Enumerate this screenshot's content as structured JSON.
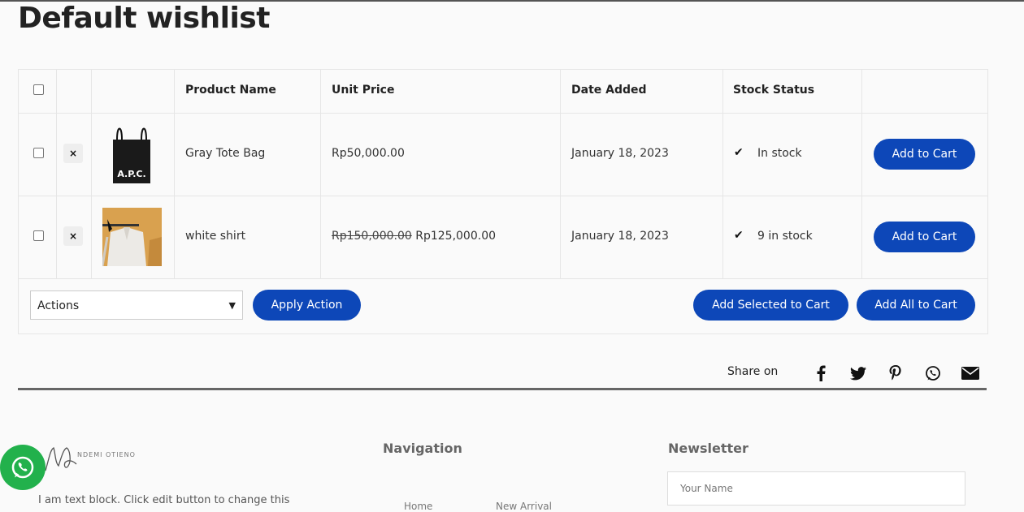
{
  "page": {
    "title": "Default wishlist"
  },
  "table": {
    "headers": {
      "product_name": "Product Name",
      "unit_price": "Unit Price",
      "date_added": "Date Added",
      "stock_status": "Stock Status"
    },
    "rows": [
      {
        "name": "Gray Tote Bag",
        "price": "Rp50,000.00",
        "old_price": "",
        "date": "January 18, 2023",
        "stock": "In stock",
        "add_label": "Add to Cart",
        "image_text": "A.P.C."
      },
      {
        "name": "white shirt",
        "price": "Rp125,000.00",
        "old_price": "Rp150,000.00",
        "date": "January 18, 2023",
        "stock": "9 in stock",
        "add_label": "Add to Cart"
      }
    ],
    "remove_symbol": "×",
    "check_symbol": "✔"
  },
  "actions": {
    "select_value": "Actions",
    "apply_label": "Apply Action",
    "add_selected_label": "Add Selected to Cart",
    "add_all_label": "Add All to Cart"
  },
  "share": {
    "label": "Share on",
    "icons": [
      "facebook-icon",
      "twitter-icon",
      "pinterest-icon",
      "whatsapp-icon",
      "email-icon"
    ]
  },
  "footer": {
    "logo_text": "NDEMI OTIENO",
    "text_block": "I am text block. Click edit button to change this",
    "navigation_heading": "Navigation",
    "nav_items": [
      "Home",
      "New Arrival"
    ],
    "newsletter_heading": "Newsletter",
    "name_placeholder": "Your Name"
  },
  "colors": {
    "primary": "#0d47b8",
    "whatsapp": "#22b14c"
  }
}
